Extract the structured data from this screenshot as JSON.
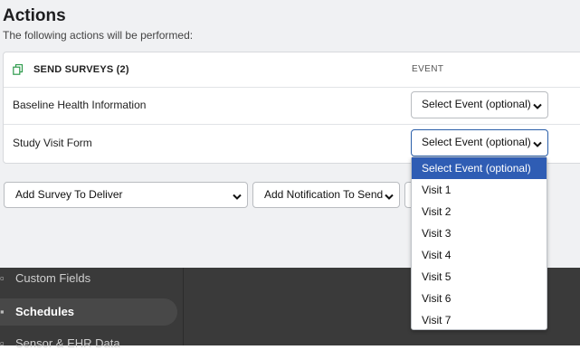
{
  "header": {
    "title": "Actions",
    "subtitle": "The following actions will be performed:"
  },
  "card": {
    "section_label": "SEND SURVEYS (2)",
    "event_column": "EVENT",
    "rows": [
      {
        "label": "Baseline Health Information",
        "event_value": "Select Event (optional)"
      },
      {
        "label": "Study Visit Form",
        "event_value": "Select Event (optional)"
      }
    ]
  },
  "controls": {
    "add_survey": "Add Survey To Deliver",
    "add_notification": "Add Notification To Send"
  },
  "dropdown": {
    "options": [
      "Select Event (optional)",
      "Visit 1",
      "Visit 2",
      "Visit 3",
      "Visit 4",
      "Visit 5",
      "Visit 6",
      "Visit 7"
    ],
    "selected_index": 0
  },
  "sidebar": {
    "items": [
      {
        "label": "Custom Fields",
        "icon": "document-icon"
      },
      {
        "label": "Schedules",
        "icon": "calendar-icon",
        "active": true
      },
      {
        "label": "Sensor & EHR Data",
        "icon": "sensor-icon"
      }
    ]
  },
  "colors": {
    "accent": "#2f5db4",
    "copy_icon": "#2e9b4c",
    "dark_background": "#3a3a3a"
  }
}
